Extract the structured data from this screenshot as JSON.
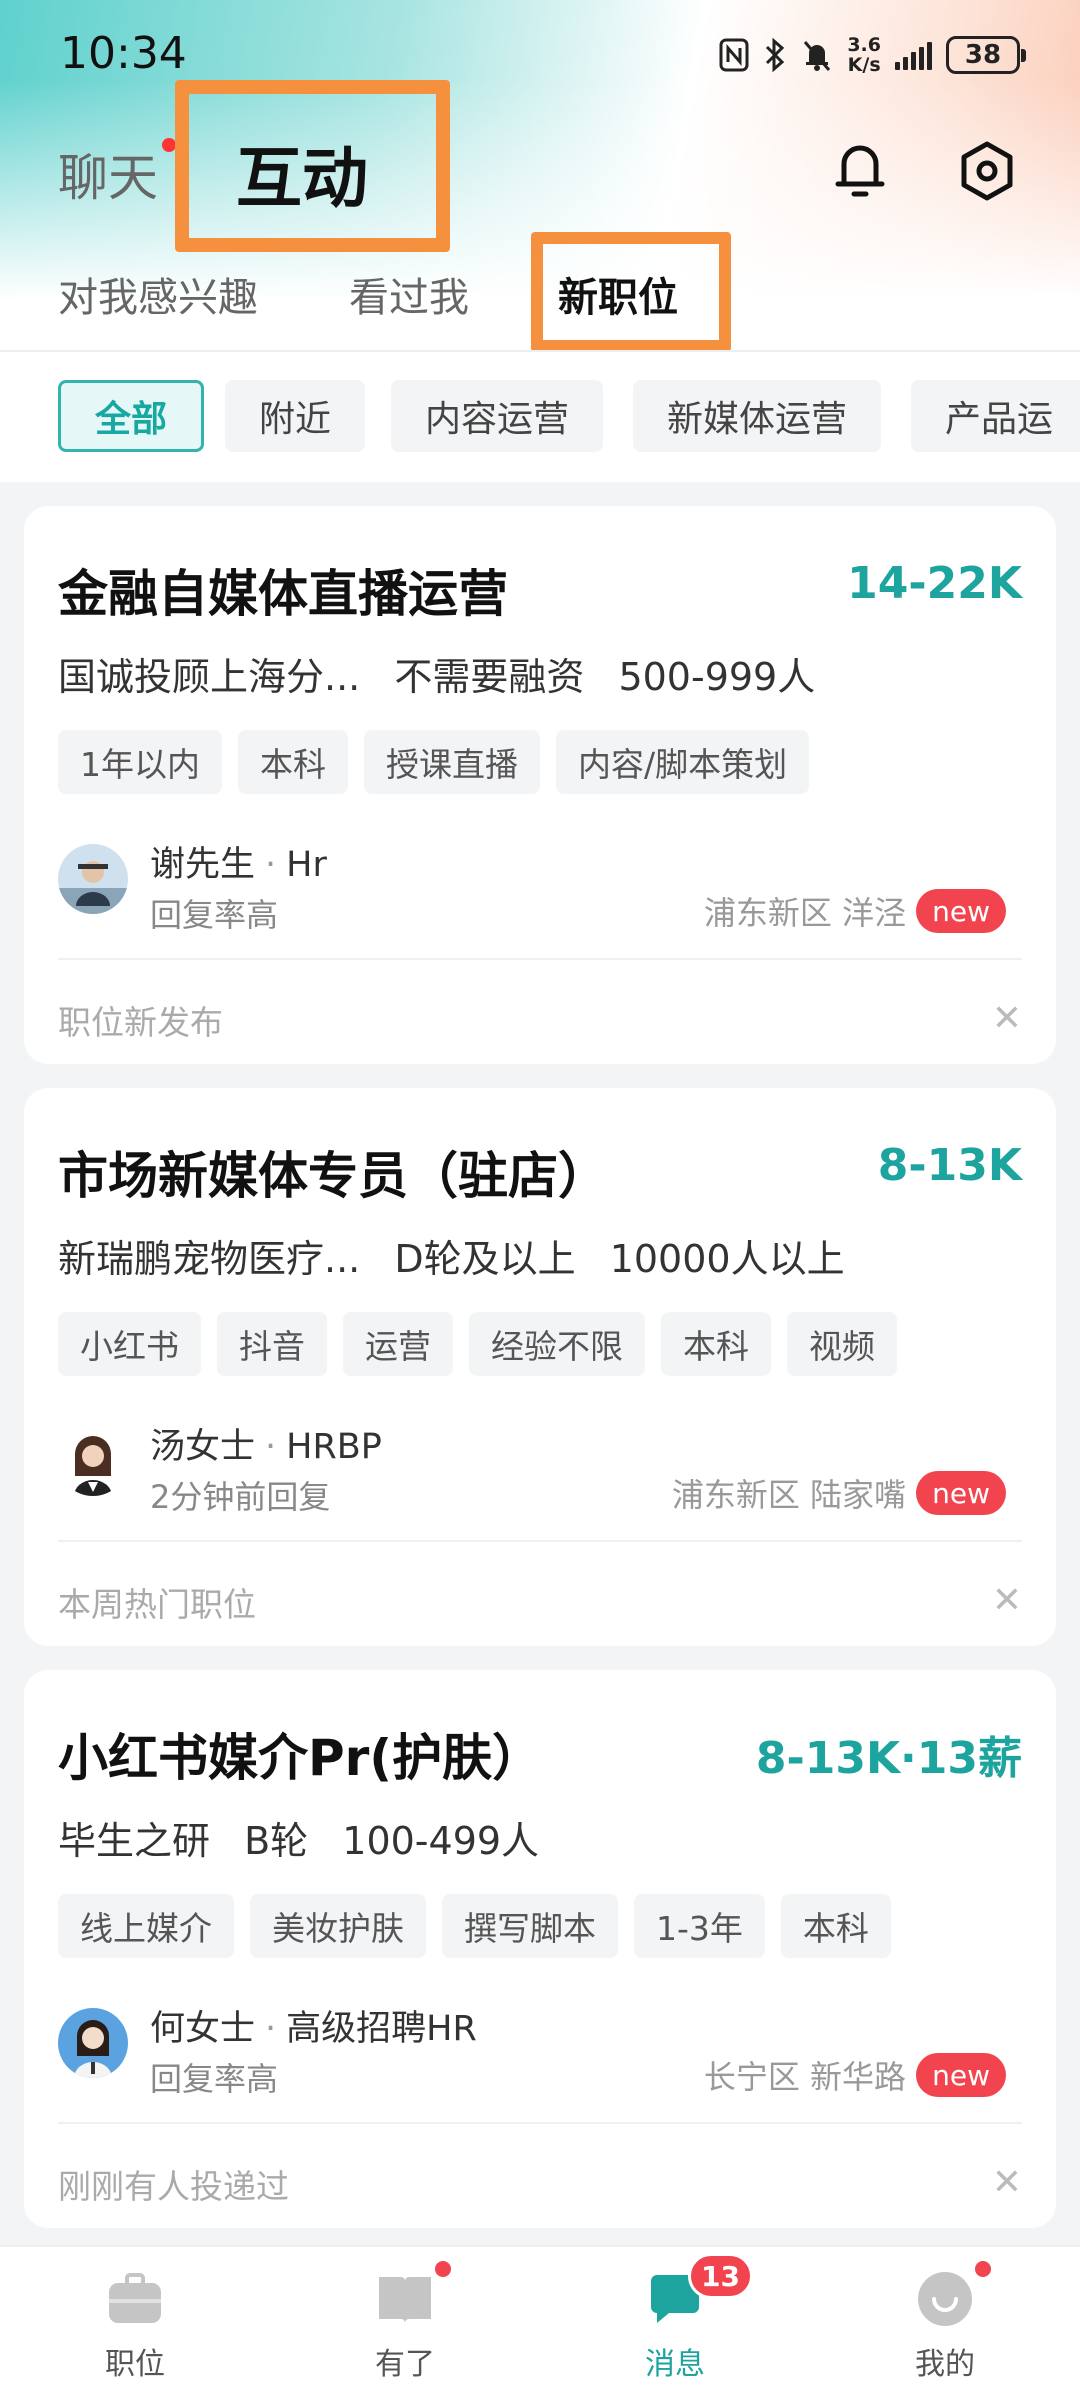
{
  "status_bar": {
    "time": "10:34",
    "speed_value": "3.6",
    "speed_unit": "K/s",
    "battery": "38"
  },
  "header": {
    "chat_tab": "聊天",
    "active_tab": "互动"
  },
  "sub_tabs": [
    "对我感兴趣",
    "看过我",
    "新职位"
  ],
  "filters": [
    "全部",
    "附近",
    "内容运营",
    "新媒体运营",
    "产品运"
  ],
  "jobs": [
    {
      "title": "金融自媒体直播运营",
      "salary": "14-22K",
      "company": "国诚投顾上海分...",
      "funding": "不需要融资",
      "size": "500-999人",
      "tags": [
        "1年以内",
        "本科",
        "授课直播",
        "内容/脚本策划"
      ],
      "recruiter": "谢先生",
      "role": "Hr",
      "reply": "回复率高",
      "location": "浦东新区 洋泾",
      "badge": "new",
      "footnote": "职位新发布"
    },
    {
      "title": "市场新媒体专员（驻店）",
      "salary": "8-13K",
      "company": "新瑞鹏宠物医疗...",
      "funding": "D轮及以上",
      "size": "10000人以上",
      "tags": [
        "小红书",
        "抖音",
        "运营",
        "经验不限",
        "本科",
        "视频"
      ],
      "recruiter": "汤女士",
      "role": "HRBP",
      "reply": "2分钟前回复",
      "location": "浦东新区 陆家嘴",
      "badge": "new",
      "footnote": "本周热门职位"
    },
    {
      "title": "小红书媒介Pr(护肤）",
      "salary": "8-13K·13薪",
      "company": "毕生之研",
      "funding": "B轮",
      "size": "100-499人",
      "tags": [
        "线上媒介",
        "美妆护肤",
        "撰写脚本",
        "1-3年",
        "本科"
      ],
      "recruiter": "何女士",
      "role": "高级招聘HR",
      "reply": "回复率高",
      "location": "长宁区 新华路",
      "badge": "new",
      "footnote": "刚刚有人投递过"
    }
  ],
  "bottom_nav": [
    {
      "label": "职位",
      "icon": "briefcase-icon"
    },
    {
      "label": "有了",
      "icon": "book-icon"
    },
    {
      "label": "消息",
      "icon": "chat-icon",
      "badge": "13"
    },
    {
      "label": "我的",
      "icon": "profile-icon"
    }
  ],
  "colors": {
    "accent": "#1ea49e",
    "highlight_box": "#f5913e",
    "badge_red": "#f2444e"
  }
}
